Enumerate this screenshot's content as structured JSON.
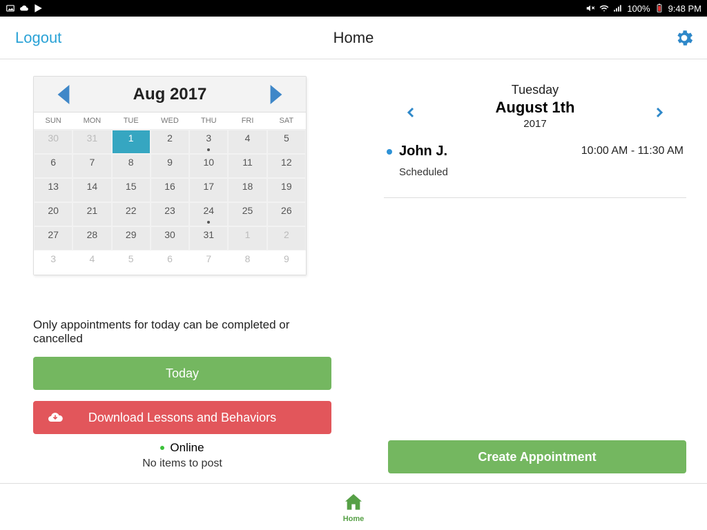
{
  "statusbar": {
    "battery": "100%",
    "time": "9:48 PM"
  },
  "header": {
    "logout": "Logout",
    "title": "Home"
  },
  "calendar": {
    "title": "Aug 2017",
    "dow": [
      "SUN",
      "MON",
      "TUE",
      "WED",
      "THU",
      "FRI",
      "SAT"
    ],
    "rows": [
      [
        {
          "n": "30",
          "out": true
        },
        {
          "n": "31",
          "out": true
        },
        {
          "n": "1",
          "sel": true
        },
        {
          "n": "2"
        },
        {
          "n": "3",
          "dot": true
        },
        {
          "n": "4"
        },
        {
          "n": "5"
        }
      ],
      [
        {
          "n": "6"
        },
        {
          "n": "7"
        },
        {
          "n": "8"
        },
        {
          "n": "9"
        },
        {
          "n": "10"
        },
        {
          "n": "11"
        },
        {
          "n": "12"
        }
      ],
      [
        {
          "n": "13"
        },
        {
          "n": "14"
        },
        {
          "n": "15"
        },
        {
          "n": "16"
        },
        {
          "n": "17"
        },
        {
          "n": "18"
        },
        {
          "n": "19"
        }
      ],
      [
        {
          "n": "20"
        },
        {
          "n": "21"
        },
        {
          "n": "22"
        },
        {
          "n": "23"
        },
        {
          "n": "24",
          "dot": true
        },
        {
          "n": "25"
        },
        {
          "n": "26"
        }
      ],
      [
        {
          "n": "27"
        },
        {
          "n": "28"
        },
        {
          "n": "29"
        },
        {
          "n": "30"
        },
        {
          "n": "31"
        },
        {
          "n": "1",
          "out": true
        },
        {
          "n": "2",
          "out": true
        }
      ],
      [
        {
          "n": "3",
          "out": true,
          "blank": true
        },
        {
          "n": "4",
          "out": true,
          "blank": true
        },
        {
          "n": "5",
          "out": true,
          "blank": true
        },
        {
          "n": "6",
          "out": true,
          "blank": true
        },
        {
          "n": "7",
          "out": true,
          "blank": true
        },
        {
          "n": "8",
          "out": true,
          "blank": true
        },
        {
          "n": "9",
          "out": true,
          "blank": true
        }
      ]
    ]
  },
  "left": {
    "notice": "Only appointments for today can be completed or cancelled",
    "today": "Today",
    "download": "Download Lessons and Behaviors",
    "online": "Online",
    "noitems": "No items to post"
  },
  "right": {
    "dayname": "Tuesday",
    "daydate": "August 1th",
    "dayyear": "2017",
    "appt": {
      "name": "John J.",
      "status": "Scheduled",
      "time": "10:00 AM - 11:30 AM"
    },
    "create": "Create Appointment"
  },
  "bottom": {
    "home": "Home"
  },
  "colors": {
    "accentBlue": "#2e92d6",
    "arrowBlue": "#3f87c8",
    "green": "#74b760",
    "red": "#e2565b"
  }
}
